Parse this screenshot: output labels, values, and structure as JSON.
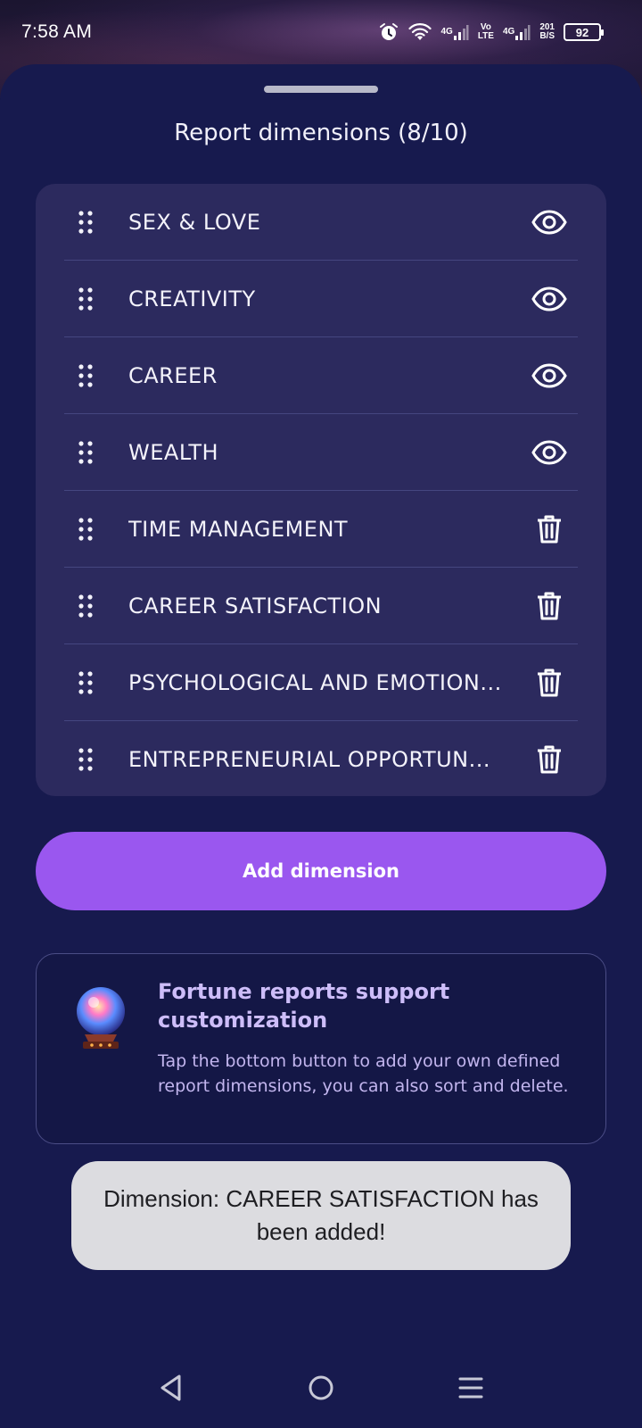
{
  "status_bar": {
    "time": "7:58 AM",
    "net1": "4G",
    "volte_top": "Vo",
    "volte_bottom": "LTE",
    "net2": "4G",
    "speed_top": "201",
    "speed_bottom": "B/S",
    "battery": "92"
  },
  "sheet": {
    "title": "Report dimensions (8/10)"
  },
  "dimensions": [
    {
      "label": "SEX & LOVE",
      "action": "eye-icon"
    },
    {
      "label": "CREATIVITY",
      "action": "eye-icon"
    },
    {
      "label": "CAREER",
      "action": "eye-icon"
    },
    {
      "label": "WEALTH",
      "action": "eye-icon"
    },
    {
      "label": "TIME MANAGEMENT",
      "action": "trash-icon"
    },
    {
      "label": "CAREER SATISFACTION",
      "action": "trash-icon"
    },
    {
      "label": "PSYCHOLOGICAL AND EMOTION...",
      "action": "trash-icon"
    },
    {
      "label": "ENTREPRENEURIAL OPPORTUN...",
      "action": "trash-icon"
    }
  ],
  "add_button": {
    "label": "Add dimension"
  },
  "info": {
    "title": "Fortune reports support customization",
    "body": "Tap the bottom button to add your own defined report dimensions, you can also sort and delete."
  },
  "toast": {
    "text": "Dimension: CAREER SATISFACTION has been added!"
  },
  "nav": {
    "back": "back-icon",
    "home": "home-icon",
    "menu": "menu-icon"
  },
  "colors": {
    "sheet_bg": "#171a4e",
    "card_bg": "#2c2a5e",
    "accent": "#9a57ef",
    "info_title": "#cdbdf9",
    "toast_bg": "#dcdce0"
  }
}
